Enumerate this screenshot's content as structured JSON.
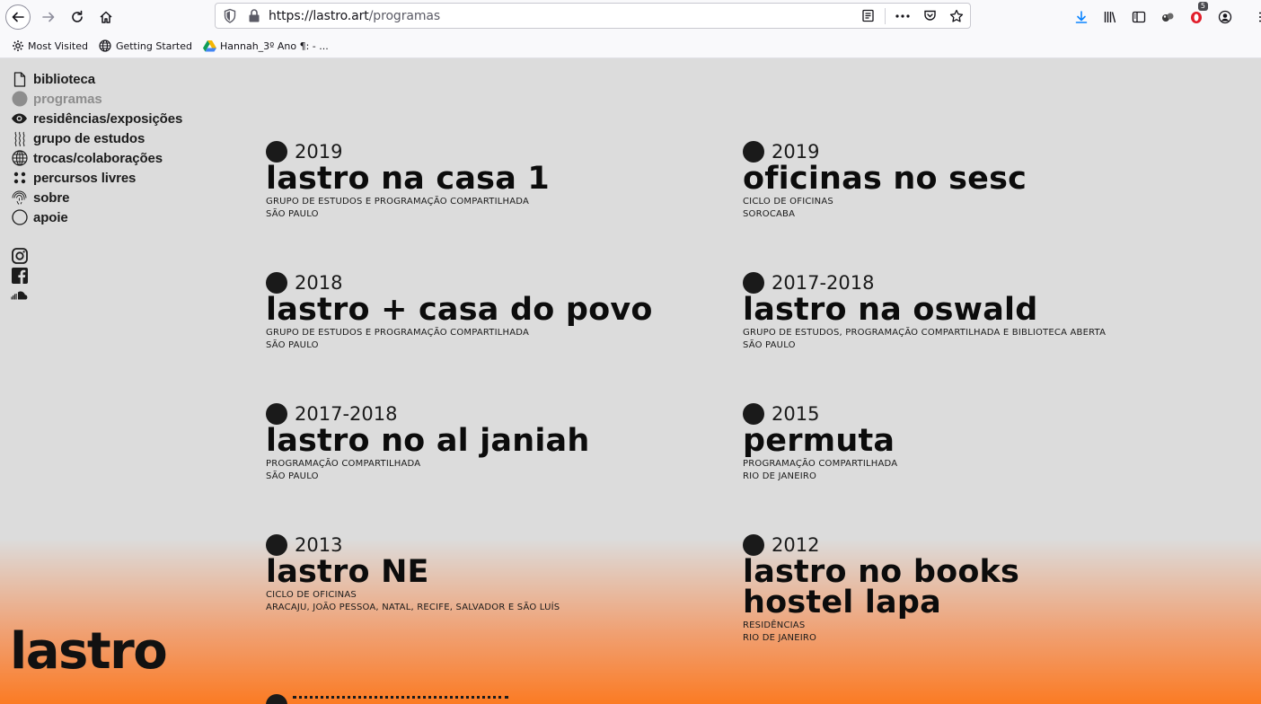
{
  "browser": {
    "url_host": "https://lastro.art",
    "url_path": "/programas",
    "badge_count": "5",
    "bookmarks": [
      {
        "label": "Most Visited",
        "icon": "gear-icon"
      },
      {
        "label": "Getting Started",
        "icon": "globe-icon"
      },
      {
        "label": "Hannah_3º Ano ¶: - ...",
        "icon": "google-drive-icon"
      }
    ]
  },
  "nav": {
    "items": [
      {
        "label": "biblioteca",
        "icon": "document-icon",
        "active": false
      },
      {
        "label": "programas",
        "icon": "filled-circle-icon",
        "active": true
      },
      {
        "label": "residências/exposições",
        "icon": "eye-icon",
        "active": false
      },
      {
        "label": "grupo de estudos",
        "icon": "wavy-lines-icon",
        "active": false
      },
      {
        "label": "trocas/colaborações",
        "icon": "globe-icon",
        "active": false
      },
      {
        "label": "percursos livres",
        "icon": "four-dots-icon",
        "active": false
      },
      {
        "label": "sobre",
        "icon": "fingerprint-icon",
        "active": false
      },
      {
        "label": "apoie",
        "icon": "circle-outline-icon",
        "active": false
      }
    ],
    "social": [
      "instagram-icon",
      "facebook-icon",
      "soundcloud-icon"
    ]
  },
  "logo": "lastro",
  "programs": [
    {
      "year": "2019",
      "title": "lastro na casa 1",
      "line1": "GRUPO DE ESTUDOS E PROGRAMAÇÃO COMPARTILHADA",
      "line2": "SÃO PAULO"
    },
    {
      "year": "2019",
      "title": "oficinas no sesc",
      "line1": "CICLO DE OFICINAS",
      "line2": "SOROCABA"
    },
    {
      "year": "2018",
      "title": "lastro + casa do povo",
      "line1": "GRUPO DE ESTUDOS E PROGRAMAÇÃO COMPARTILHADA",
      "line2": "SÃO PAULO"
    },
    {
      "year": "2017-2018",
      "title": "lastro na oswald",
      "line1": "GRUPO DE ESTUDOS, PROGRAMAÇÃO COMPARTILHADA E BIBLIOTECA ABERTA",
      "line2": "SÃO PAULO"
    },
    {
      "year": "2017-2018",
      "title": "lastro no al janiah",
      "line1": "PROGRAMAÇÃO COMPARTILHADA",
      "line2": "SÃO PAULO"
    },
    {
      "year": "2015",
      "title": "permuta",
      "line1": "PROGRAMAÇÃO COMPARTILHADA",
      "line2": "RIO DE JANEIRO"
    },
    {
      "year": "2013",
      "title": "lastro NE",
      "line1": "CICLO DE OFICINAS",
      "line2": "ARACAJU, JOÃO PESSOA, NATAL, RECIFE, SALVADOR E SÃO LUÍS"
    },
    {
      "year": "2012",
      "title": "lastro no books hostel lapa",
      "line1": "RESIDÊNCIAS",
      "line2": "RIO DE JANEIRO"
    }
  ]
}
